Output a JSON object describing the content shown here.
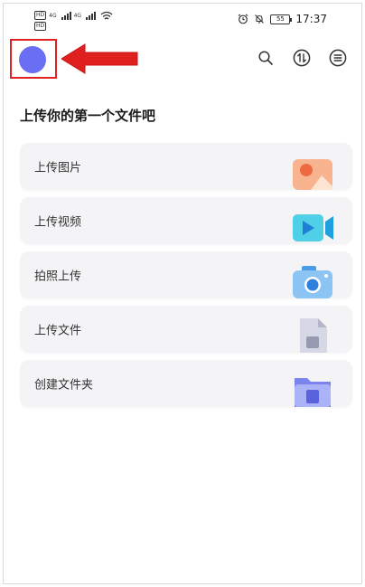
{
  "status_bar": {
    "sim1_badge": "HD",
    "sim2_badge": "HD",
    "sim_label": "4G",
    "time": "17:37",
    "battery": "55",
    "icons": [
      "alarm-icon",
      "mute-icon",
      "wifi-icon",
      "signal-icon"
    ]
  },
  "header": {
    "avatar_color": "#6a6ef5",
    "highlight_color": "#e02222",
    "icons": [
      "search-icon",
      "transfer-icon",
      "menu-icon"
    ]
  },
  "page": {
    "title": "上传你的第一个文件吧"
  },
  "actions": [
    {
      "label": "上传图片",
      "icon": "image-icon"
    },
    {
      "label": "上传视频",
      "icon": "video-icon"
    },
    {
      "label": "拍照上传",
      "icon": "camera-icon"
    },
    {
      "label": "上传文件",
      "icon": "file-icon"
    },
    {
      "label": "创建文件夹",
      "icon": "folder-icon"
    }
  ]
}
